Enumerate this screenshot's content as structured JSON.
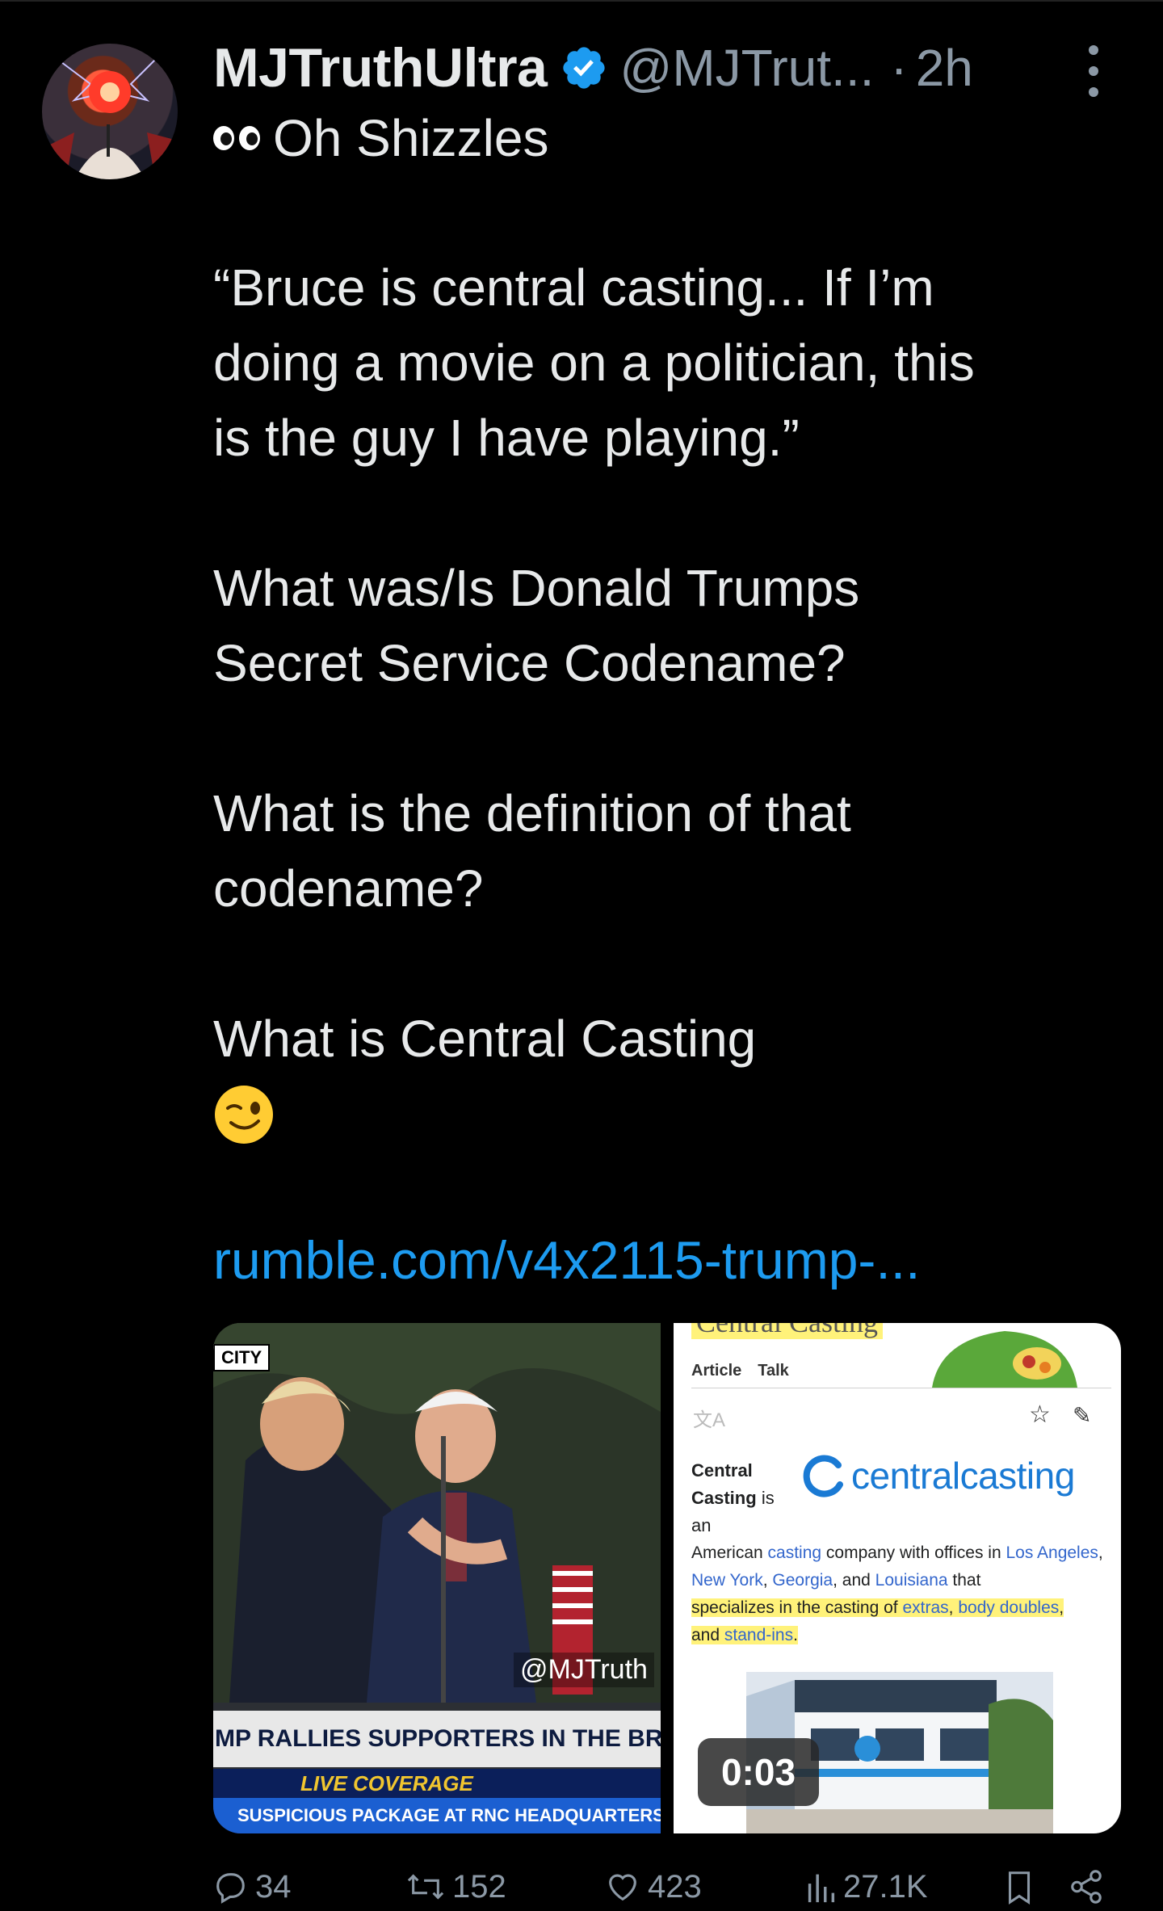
{
  "colors": {
    "background": "#000000",
    "text": "#e7e9ea",
    "muted": "#8b98a5",
    "link": "#1d9bf0",
    "verified": "#1d9bf0"
  },
  "post": {
    "author_name": "MJTruthUltra",
    "handle": "@MJTrut...",
    "separator": "·",
    "time": "2h",
    "subheading": "Oh Shizzles",
    "quote_line1": "“Bruce is central casting... If I’m",
    "quote_line2": "doing a movie on a politician, this",
    "quote_line3": "is the guy I have playing.”",
    "question1_line1": "What was/Is Donald Trumps",
    "question1_line2": "Secret Service Codename?",
    "question2_line1": "What is the definition of that",
    "question2_line2": "codename?",
    "question3": "What is Central Casting",
    "link_text": "rumble.com/v4x2115-trump-..."
  },
  "media": {
    "left_video": {
      "corner_tag": "CITY",
      "watermark": "@MJTruth",
      "banner": "MP RALLIES SUPPORTERS IN THE BRO",
      "live": "LIVE COVERAGE",
      "ticker": "SUSPICIOUS PACKAGE AT RNC HEADQUARTERS REP"
    },
    "right_video": {
      "title": "Central Casting",
      "tab_article": "Article",
      "tab_talk": "Talk",
      "def_term": "Central Casting",
      "def_is": "is",
      "def_an": "an",
      "logo_text": "centralcasting",
      "body_1": "American ",
      "body_casting": "casting",
      "body_2": " company with offices in ",
      "body_la": "Los Angeles",
      "body_3": ", ",
      "body_ny": "New York",
      "body_4": ", ",
      "body_ga": "Georgia",
      "body_5": ", and ",
      "body_louisiana": "Louisiana",
      "body_6": " that",
      "body_7": "specializes in the casting of ",
      "body_extras": "extras",
      "body_8": ", ",
      "body_doubles": "body doubles",
      "body_9": ",",
      "body_10": "and ",
      "body_standins": "stand-ins",
      "body_11": ".",
      "duration": "0:03"
    }
  },
  "actions": {
    "replies": "34",
    "reposts": "152",
    "likes": "423",
    "views": "27.1K"
  }
}
